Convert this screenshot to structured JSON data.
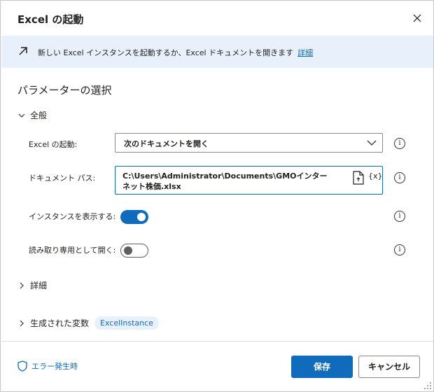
{
  "dialog": {
    "title": "Excel の起動",
    "close_icon": "close-icon"
  },
  "info": {
    "icon": "arrow-up-right-icon",
    "text": "新しい Excel インスタンスを起動するか、Excel ドキュメントを開きます",
    "link": "詳細"
  },
  "section_title": "パラメーターの選択",
  "groups": {
    "general": "全般",
    "details": "詳細",
    "variables": "生成された変数"
  },
  "params": {
    "launch_label": "Excel の起動:",
    "launch_value": "次のドキュメントを開く",
    "path_label": "ドキュメント パス:",
    "path_value": "C:\\Users\\Administrator\\Documents\\GMOインターネット株価.xlsx",
    "var_button": "{x}",
    "show_instance_label": "インスタンスを表示する:",
    "show_instance_on": true,
    "readonly_label": "読み取り専用として開く:",
    "readonly_on": false
  },
  "variables": {
    "name": "ExcelInstance"
  },
  "footer": {
    "on_error": "エラー発生時",
    "save": "保存",
    "cancel": "キャンセル"
  },
  "colors": {
    "accent": "#0f6cbd",
    "info_bg": "#e8f1fb"
  }
}
